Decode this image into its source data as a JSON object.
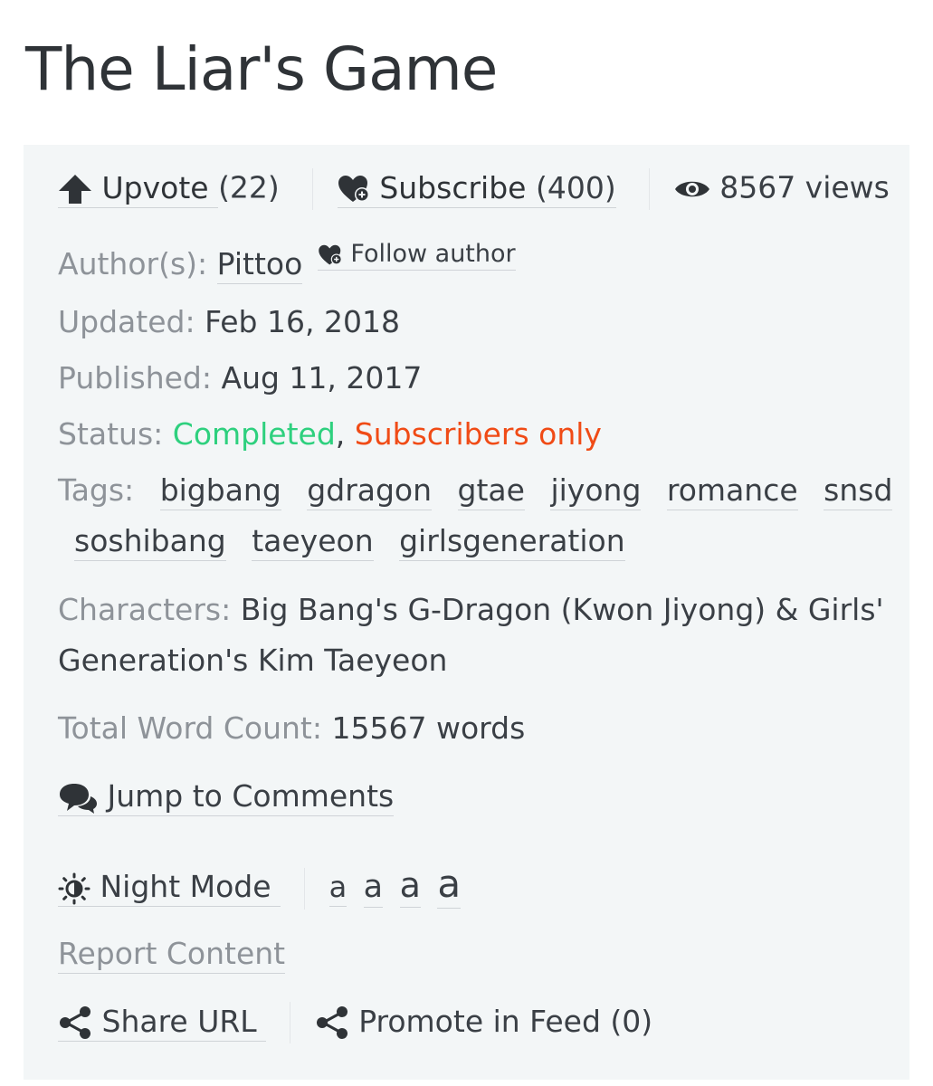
{
  "story": {
    "title": "The Liar's Game"
  },
  "actions": {
    "upvote_label": "Upvote",
    "upvote_count": "(22)",
    "subscribe_label": "Subscribe",
    "subscribe_count": "(400)",
    "views": "8567 views"
  },
  "meta": {
    "author_label": "Author(s):",
    "author_name": "Pittoo",
    "follow_label": "Follow author",
    "updated_label": "Updated:",
    "updated_value": "Feb 16, 2018",
    "published_label": "Published:",
    "published_value": "Aug 11, 2017",
    "status_label": "Status:",
    "status_completed": "Completed",
    "status_comma": ",",
    "status_subscribers": "Subscribers only",
    "tags_label": "Tags:",
    "tags": [
      "bigbang",
      "gdragon",
      "gtae",
      "jiyong",
      "romance",
      "snsd",
      "soshibang",
      "taeyeon",
      "girlsgeneration"
    ],
    "characters_label": "Characters:",
    "characters_line1": "Big Bang's G-Dragon (Kwon Jiyong) & Girls'",
    "characters_line2": "Generation's Kim Taeyeon",
    "wordcount_label": "Total Word Count:",
    "wordcount_value": "15567 words"
  },
  "tools": {
    "comments_label": "Jump to Comments",
    "night_mode_label": "Night Mode",
    "font_sizes": [
      "a",
      "a",
      "a",
      "a"
    ],
    "report_label": "Report Content",
    "share_label": "Share URL",
    "promote_label": "Promote in Feed (0)"
  },
  "colors": {
    "panel_bg": "#f3f6f7",
    "status_completed": "#2ed07e",
    "status_subscribers": "#f04b16"
  }
}
